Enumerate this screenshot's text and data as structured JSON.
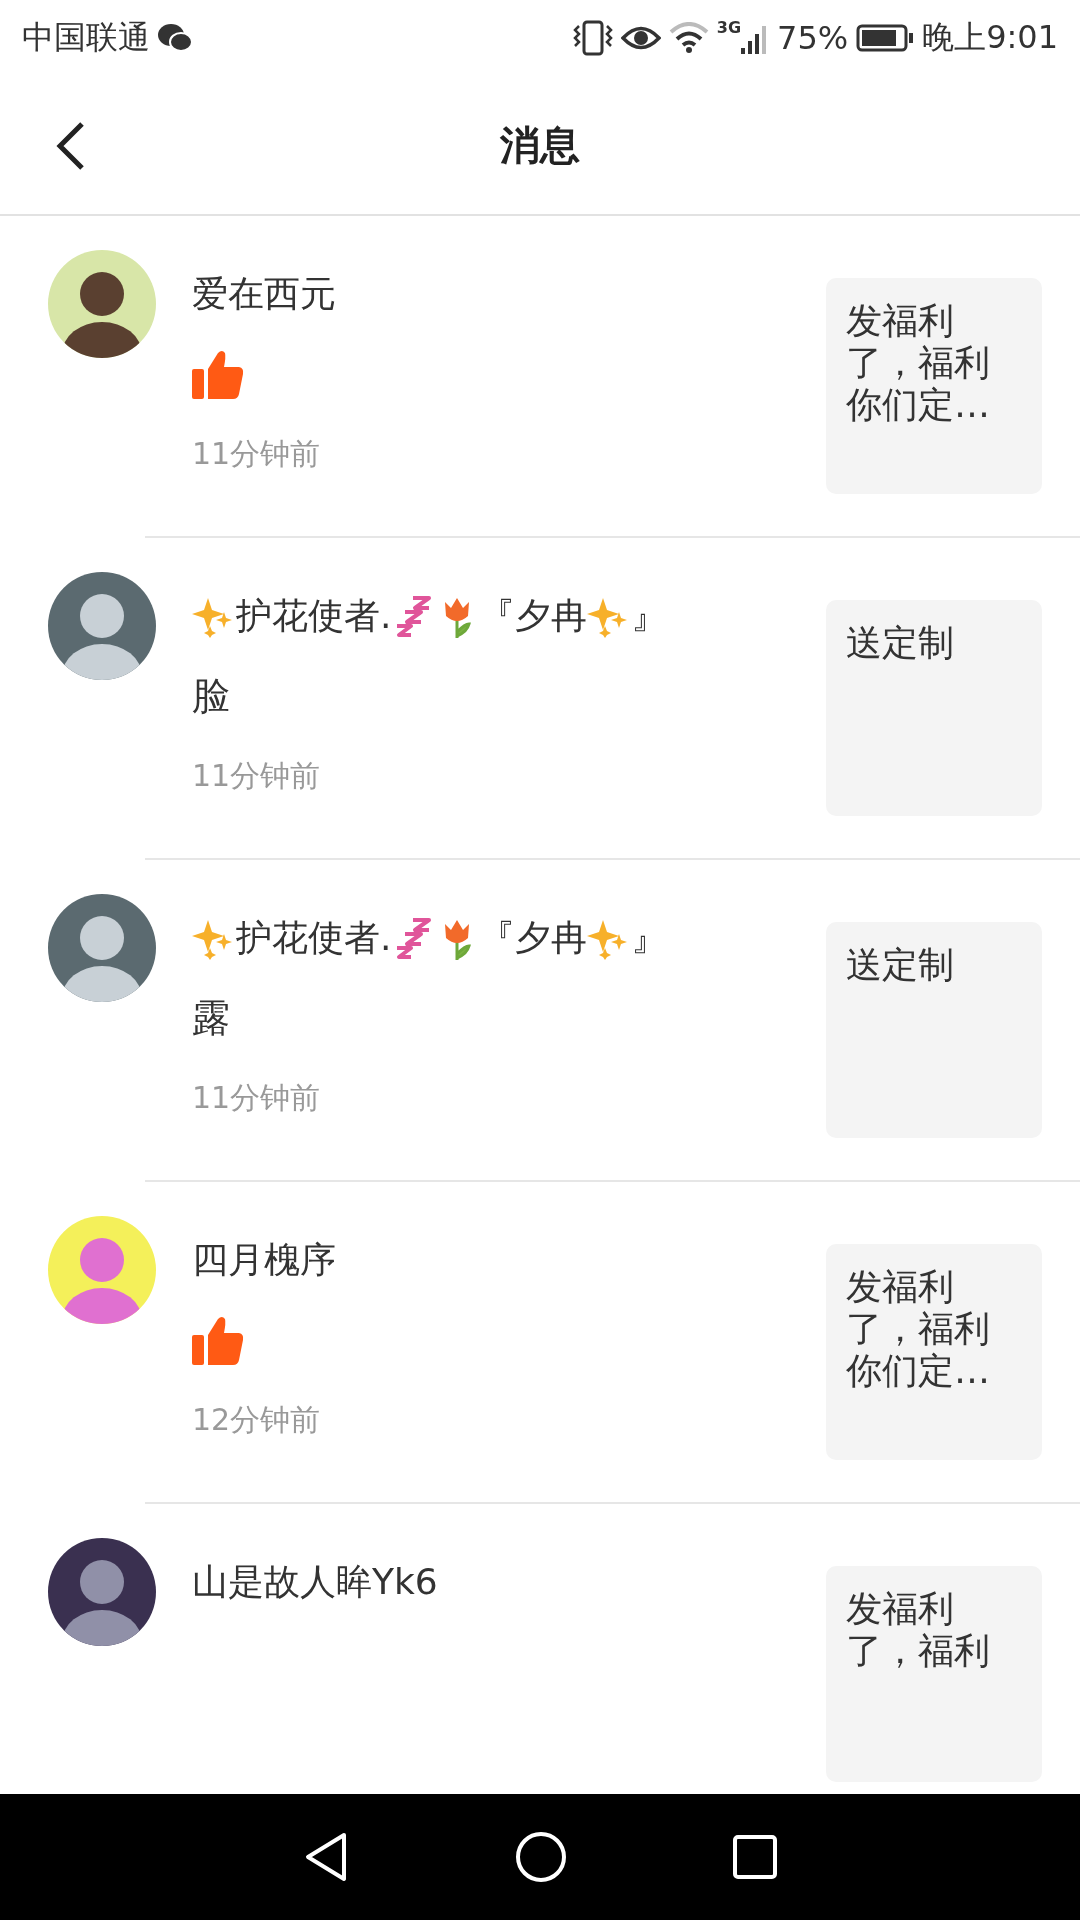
{
  "status_bar": {
    "carrier": "中国联通",
    "network": "3G",
    "battery": "75%",
    "time": "晚上9:01"
  },
  "header": {
    "title": "消息"
  },
  "messages": [
    {
      "name": [
        {
          "kind": "text",
          "text": "爱在西元"
        }
      ],
      "content": {
        "kind": "like"
      },
      "time": "11分钟前",
      "preview": "发福利了，福利你们定…"
    },
    {
      "name": [
        {
          "kind": "sparkles"
        },
        {
          "kind": "text",
          "text": "护花使者."
        },
        {
          "kind": "zzz"
        },
        {
          "kind": "tulip"
        },
        {
          "kind": "text",
          "text": "『夕冉"
        },
        {
          "kind": "sparkles"
        },
        {
          "kind": "text",
          "text": "』"
        }
      ],
      "content": {
        "kind": "text",
        "text": "脸"
      },
      "time": "11分钟前",
      "preview": "送定制"
    },
    {
      "name": [
        {
          "kind": "sparkles"
        },
        {
          "kind": "text",
          "text": "护花使者."
        },
        {
          "kind": "zzz"
        },
        {
          "kind": "tulip"
        },
        {
          "kind": "text",
          "text": "『夕冉"
        },
        {
          "kind": "sparkles"
        },
        {
          "kind": "text",
          "text": "』"
        }
      ],
      "content": {
        "kind": "text",
        "text": "露"
      },
      "time": "11分钟前",
      "preview": "送定制"
    },
    {
      "name": [
        {
          "kind": "text",
          "text": "四月槐序"
        }
      ],
      "content": {
        "kind": "like"
      },
      "time": "12分钟前",
      "preview": "发福利了，福利你们定…"
    },
    {
      "name": [
        {
          "kind": "text",
          "text": "山是故人眸Yk6"
        }
      ],
      "preview": "发福利了，福利"
    }
  ]
}
